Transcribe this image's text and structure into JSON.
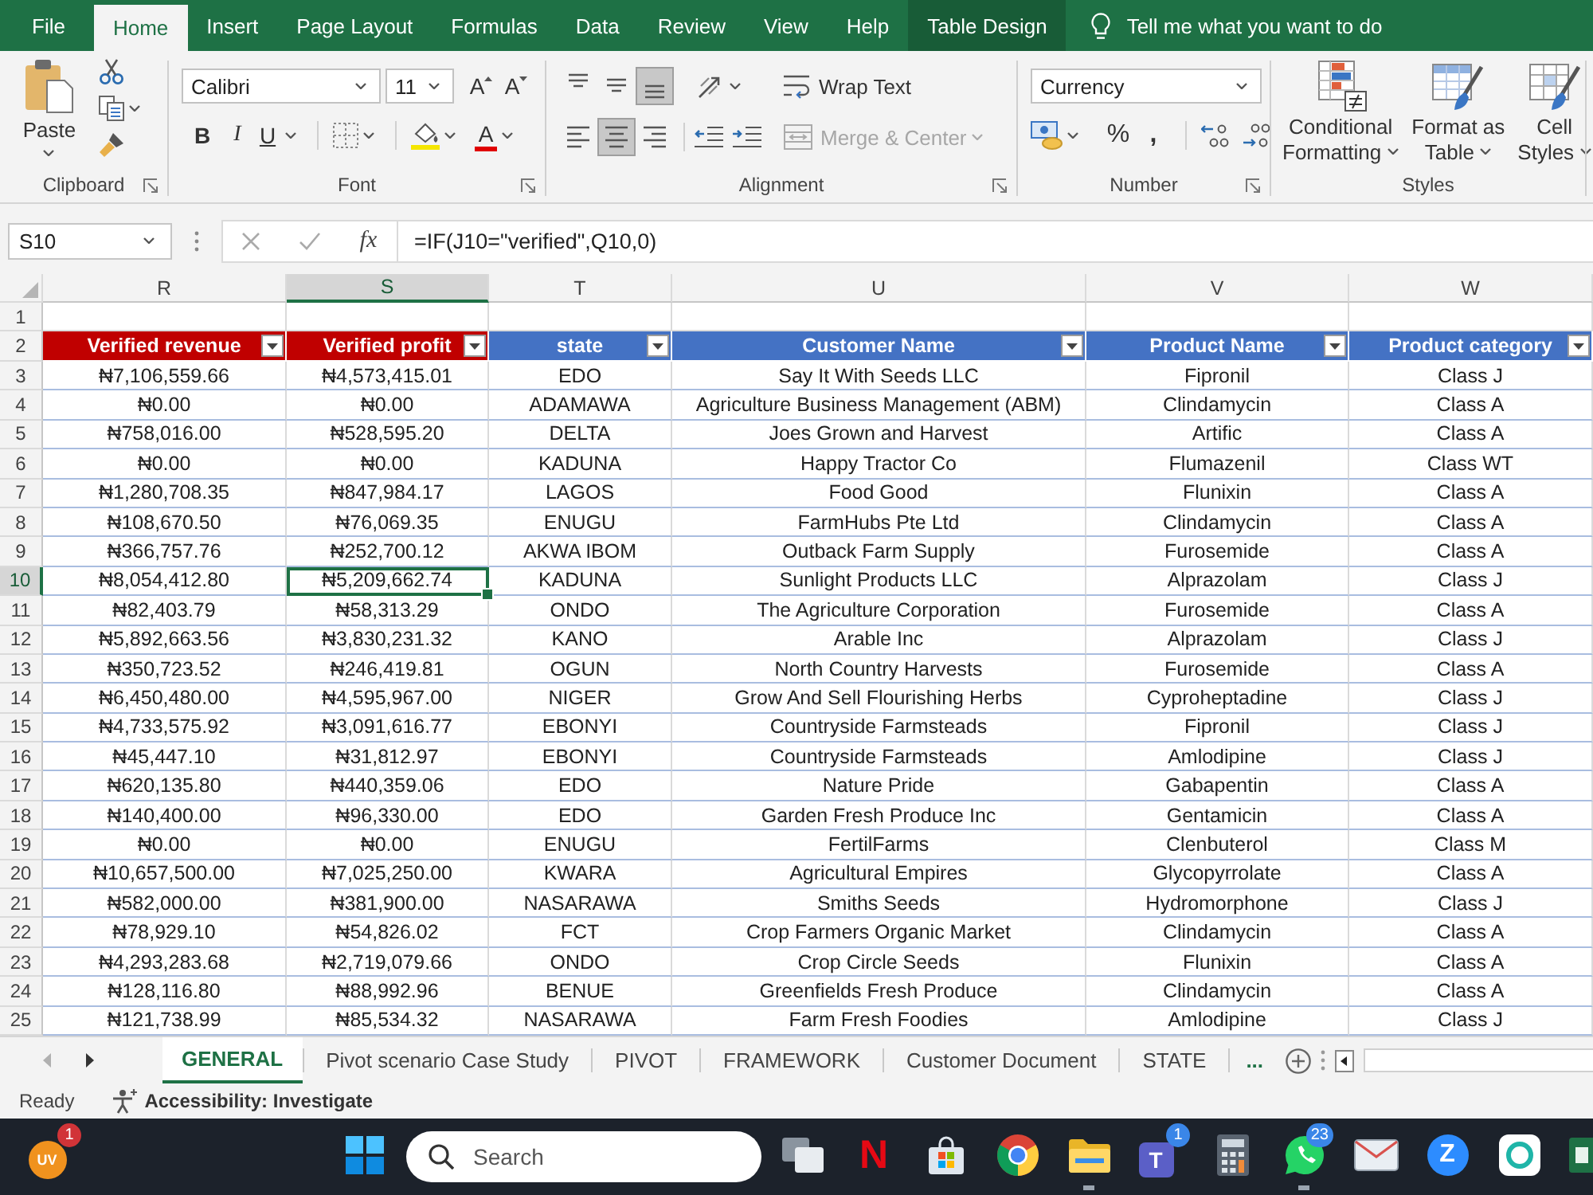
{
  "menu_bar": {
    "tabs": [
      {
        "label": "File",
        "kind": "tab",
        "selected": false
      },
      {
        "label": "Home",
        "kind": "tab",
        "selected": true
      },
      {
        "label": "Insert",
        "kind": "tab",
        "selected": false
      },
      {
        "label": "Page Layout",
        "kind": "tab",
        "selected": false
      },
      {
        "label": "Formulas",
        "kind": "tab",
        "selected": false
      },
      {
        "label": "Data",
        "kind": "tab",
        "selected": false
      },
      {
        "label": "Review",
        "kind": "tab",
        "selected": false
      },
      {
        "label": "View",
        "kind": "tab",
        "selected": false
      },
      {
        "label": "Help",
        "kind": "tab",
        "selected": false
      },
      {
        "label": "Table Design",
        "kind": "contextual",
        "selected": false
      }
    ],
    "tell_me": "Tell me what you want to do"
  },
  "ribbon": {
    "clipboard": {
      "paste": "Paste",
      "label": "Clipboard"
    },
    "font": {
      "name": "Calibri",
      "size": "11",
      "grow": "A",
      "shrink": "A",
      "bold": "B",
      "italic": "I",
      "underline": "U",
      "font_color": "A",
      "label": "Font"
    },
    "alignment": {
      "vertical": [
        {
          "kind": "top",
          "selected": false
        },
        {
          "kind": "middle",
          "selected": false
        },
        {
          "kind": "bottom",
          "selected": true
        }
      ],
      "horizontal": [
        {
          "kind": "left",
          "selected": false
        },
        {
          "kind": "center",
          "selected": true
        },
        {
          "kind": "right",
          "selected": false
        }
      ],
      "wrap_text": "Wrap Text",
      "merge": {
        "label": "Merge & Center",
        "disabled": true
      },
      "label": "Alignment"
    },
    "number": {
      "format": "Currency",
      "percent": "%",
      "comma": ",",
      "label": "Number"
    },
    "styles": {
      "buttons": [
        {
          "kind": "conditional",
          "lines": [
            "Conditional",
            "Formatting"
          ]
        },
        {
          "kind": "table",
          "lines": [
            "Format as",
            "Table"
          ]
        },
        {
          "kind": "cell",
          "lines": [
            "Cell",
            "Styles"
          ]
        }
      ],
      "label": "Styles"
    }
  },
  "formula_bar": {
    "name_box": "S10",
    "fx": "fx",
    "formula": "=IF(J10=\"verified\",Q10,0)"
  },
  "sheet": {
    "columns": [
      {
        "letter": "R",
        "selected": false
      },
      {
        "letter": "S",
        "selected": true
      },
      {
        "letter": "T",
        "selected": false
      },
      {
        "letter": "U",
        "selected": false
      },
      {
        "letter": "V",
        "selected": false
      },
      {
        "letter": "W",
        "selected": false
      }
    ],
    "blank_row": "1",
    "header_row": {
      "number": "2",
      "cells": [
        {
          "text": "Verified revenue",
          "color": "#c00000"
        },
        {
          "text": "Verified profit",
          "color": "#c00000"
        },
        {
          "text": "state",
          "color": "#4472c4"
        },
        {
          "text": "Customer Name",
          "color": "#4472c4"
        },
        {
          "text": "Product Name",
          "color": "#4472c4"
        },
        {
          "text": "Product category",
          "color": "#4472c4"
        }
      ]
    },
    "rows": [
      {
        "number": "3",
        "selected": false,
        "cells": [
          "₦7,106,559.66",
          "₦4,573,415.01",
          "EDO",
          "Say It With Seeds LLC",
          "Fipronil",
          "Class J"
        ]
      },
      {
        "number": "4",
        "selected": false,
        "cells": [
          "₦0.00",
          "₦0.00",
          "ADAMAWA",
          "Agriculture Business Management (ABM)",
          "Clindamycin",
          "Class A"
        ]
      },
      {
        "number": "5",
        "selected": false,
        "cells": [
          "₦758,016.00",
          "₦528,595.20",
          "DELTA",
          "Joes Grown and Harvest",
          "Artific",
          "Class A"
        ]
      },
      {
        "number": "6",
        "selected": false,
        "cells": [
          "₦0.00",
          "₦0.00",
          "KADUNA",
          "Happy Tractor Co",
          "Flumazenil",
          "Class WT"
        ]
      },
      {
        "number": "7",
        "selected": false,
        "cells": [
          "₦1,280,708.35",
          "₦847,984.17",
          "LAGOS",
          "Food Good",
          "Flunixin",
          "Class A"
        ]
      },
      {
        "number": "8",
        "selected": false,
        "cells": [
          "₦108,670.50",
          "₦76,069.35",
          "ENUGU",
          "FarmHubs Pte Ltd",
          "Clindamycin",
          "Class A"
        ]
      },
      {
        "number": "9",
        "selected": false,
        "cells": [
          "₦366,757.76",
          "₦252,700.12",
          "AKWA IBOM",
          "Outback Farm Supply",
          "Furosemide",
          "Class A"
        ]
      },
      {
        "number": "10",
        "selected": true,
        "cells": [
          "₦8,054,412.80",
          "₦5,209,662.74",
          "KADUNA",
          "Sunlight Products LLC",
          "Alprazolam",
          "Class J"
        ]
      },
      {
        "number": "11",
        "selected": false,
        "cells": [
          "₦82,403.79",
          "₦58,313.29",
          "ONDO",
          "The Agriculture Corporation",
          "Furosemide",
          "Class A"
        ]
      },
      {
        "number": "12",
        "selected": false,
        "cells": [
          "₦5,892,663.56",
          "₦3,830,231.32",
          "KANO",
          "Arable Inc",
          "Alprazolam",
          "Class J"
        ]
      },
      {
        "number": "13",
        "selected": false,
        "cells": [
          "₦350,723.52",
          "₦246,419.81",
          "OGUN",
          "North Country Harvests",
          "Furosemide",
          "Class A"
        ]
      },
      {
        "number": "14",
        "selected": false,
        "cells": [
          "₦6,450,480.00",
          "₦4,595,967.00",
          "NIGER",
          "Grow And Sell Flourishing Herbs",
          "Cyproheptadine",
          "Class J"
        ]
      },
      {
        "number": "15",
        "selected": false,
        "cells": [
          "₦4,733,575.92",
          "₦3,091,616.77",
          "EBONYI",
          "Countryside Farmsteads",
          "Fipronil",
          "Class J"
        ]
      },
      {
        "number": "16",
        "selected": false,
        "cells": [
          "₦45,447.10",
          "₦31,812.97",
          "EBONYI",
          "Countryside Farmsteads",
          "Amlodipine",
          "Class J"
        ]
      },
      {
        "number": "17",
        "selected": false,
        "cells": [
          "₦620,135.80",
          "₦440,359.06",
          "EDO",
          "Nature Pride",
          "Gabapentin",
          "Class A"
        ]
      },
      {
        "number": "18",
        "selected": false,
        "cells": [
          "₦140,400.00",
          "₦96,330.00",
          "EDO",
          "Garden Fresh Produce Inc",
          "Gentamicin",
          "Class A"
        ]
      },
      {
        "number": "19",
        "selected": false,
        "cells": [
          "₦0.00",
          "₦0.00",
          "ENUGU",
          "FertilFarms",
          "Clenbuterol",
          "Class M"
        ]
      },
      {
        "number": "20",
        "selected": false,
        "cells": [
          "₦10,657,500.00",
          "₦7,025,250.00",
          "KWARA",
          "Agricultural Empires",
          "Glycopyrrolate",
          "Class A"
        ]
      },
      {
        "number": "21",
        "selected": false,
        "cells": [
          "₦582,000.00",
          "₦381,900.00",
          "NASARAWA",
          "Smiths Seeds",
          "Hydromorphone",
          "Class J"
        ]
      },
      {
        "number": "22",
        "selected": false,
        "cells": [
          "₦78,929.10",
          "₦54,826.02",
          "FCT",
          "Crop Farmers Organic Market",
          "Clindamycin",
          "Class A"
        ]
      },
      {
        "number": "23",
        "selected": false,
        "cells": [
          "₦4,293,283.68",
          "₦2,719,079.66",
          "ONDO",
          "Crop Circle Seeds",
          "Flunixin",
          "Class A"
        ]
      },
      {
        "number": "24",
        "selected": false,
        "cells": [
          "₦128,116.80",
          "₦88,992.96",
          "BENUE",
          "Greenfields Fresh Produce",
          "Clindamycin",
          "Class A"
        ]
      },
      {
        "number": "25",
        "selected": false,
        "cells": [
          "₦121,738.99",
          "₦85,534.32",
          "NASARAWA",
          "Farm Fresh Foodies",
          "Amlodipine",
          "Class J"
        ]
      }
    ]
  },
  "sheet_tabs": {
    "tabs": [
      {
        "label": "GENERAL",
        "selected": true
      },
      {
        "label": "Pivot scenario Case Study",
        "selected": false
      },
      {
        "label": "PIVOT",
        "selected": false
      },
      {
        "label": "FRAMEWORK",
        "selected": false
      },
      {
        "label": "Customer Document",
        "selected": false
      },
      {
        "label": "STATE",
        "selected": false
      }
    ],
    "more": "..."
  },
  "status_bar": {
    "ready": "Ready",
    "accessibility": "Accessibility: Investigate"
  },
  "taskbar": {
    "widget": {
      "kind": "circle",
      "glyph": "UV",
      "badge": {
        "text": "1",
        "color": "#d13438"
      },
      "running": false
    },
    "search": {
      "placeholder": "Search"
    },
    "apps": [
      {
        "kind": "start",
        "running": false
      },
      {
        "kind": "taskview",
        "running": false
      },
      {
        "kind": "letter",
        "glyph": "N",
        "running": false
      },
      {
        "kind": "bag",
        "running": false
      },
      {
        "kind": "browser",
        "running": false
      },
      {
        "kind": "folder",
        "running": true
      },
      {
        "kind": "tile",
        "glyph": "T",
        "badge": {
          "text": "1",
          "color": "#3a86e8"
        },
        "running": false
      },
      {
        "kind": "calculator",
        "running": false
      },
      {
        "kind": "chat",
        "badge": {
          "text": "23",
          "color": "#3a86e8"
        },
        "running": true
      },
      {
        "kind": "mail",
        "running": false
      },
      {
        "kind": "disc",
        "glyph": "Z",
        "running": false
      },
      {
        "kind": "ring",
        "running": false
      },
      {
        "kind": "sheet",
        "running": false
      }
    ]
  }
}
